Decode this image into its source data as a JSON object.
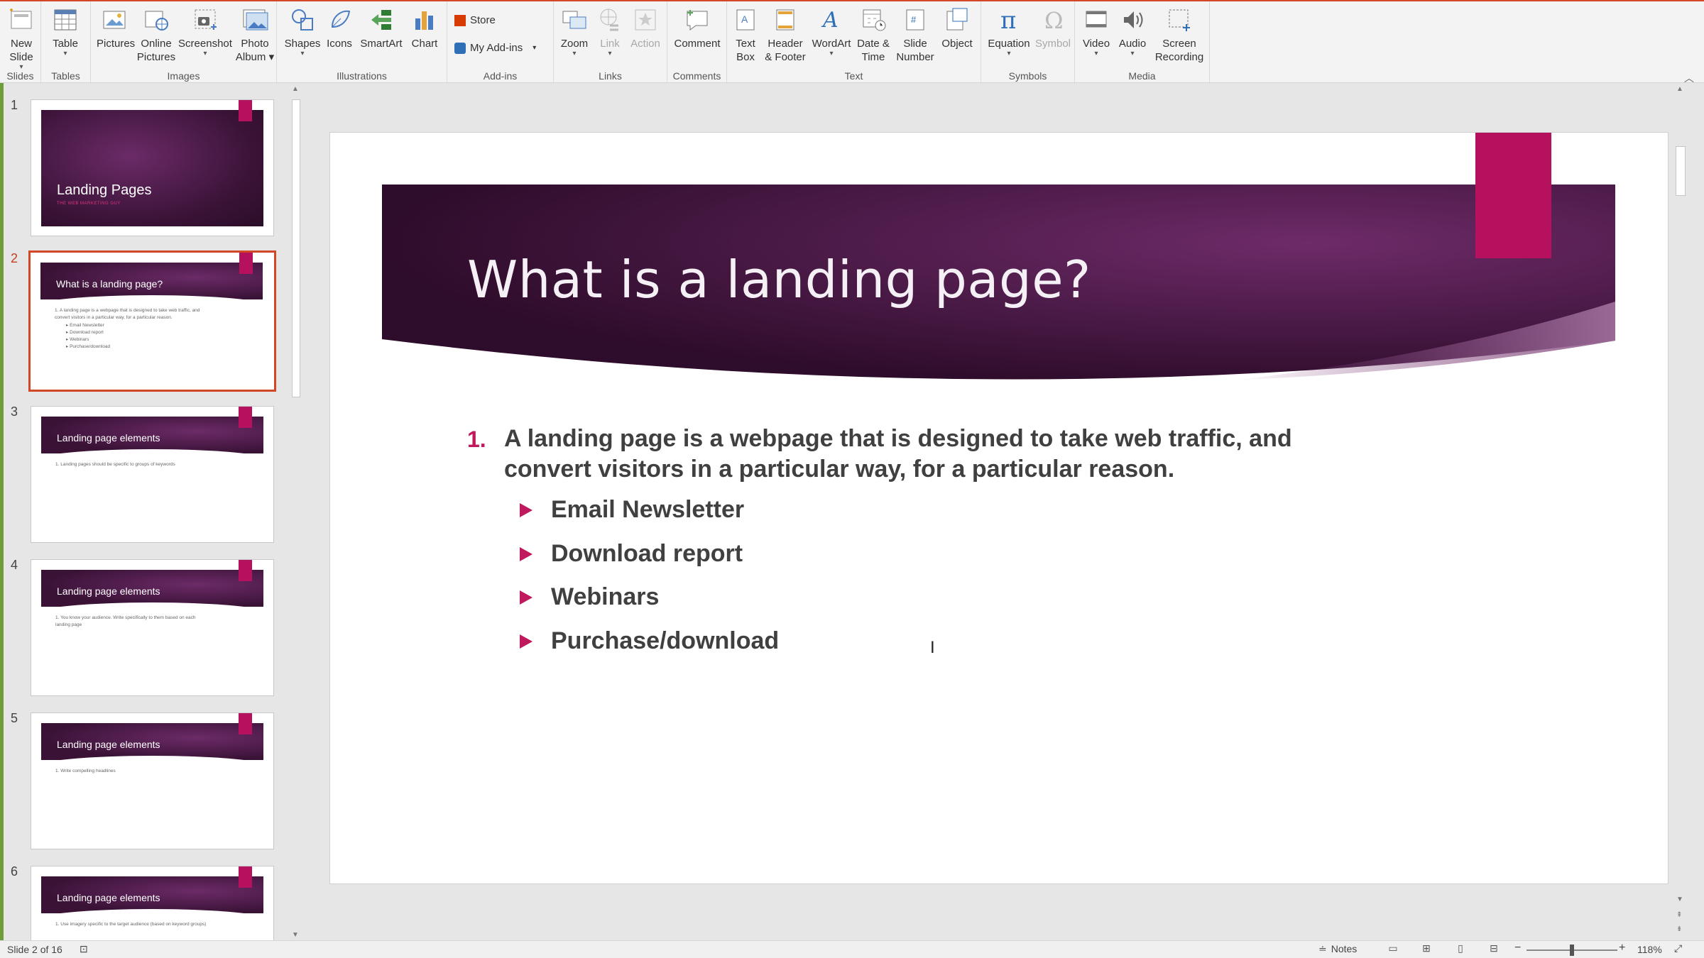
{
  "ribbon": {
    "groups": {
      "slides": "Slides",
      "tables": "Tables",
      "images": "Images",
      "illustrations": "Illustrations",
      "addins": "Add-ins",
      "links": "Links",
      "comments": "Comments",
      "text": "Text",
      "symbols": "Symbols",
      "media": "Media"
    },
    "buttons": {
      "new_slide": [
        "New",
        "Slide"
      ],
      "table": "Table",
      "pictures": "Pictures",
      "online_pictures": [
        "Online",
        "Pictures"
      ],
      "screenshot": "Screenshot",
      "photo_album": [
        "Photo",
        "Album"
      ],
      "shapes": "Shapes",
      "icons": "Icons",
      "smartart": "SmartArt",
      "chart": "Chart",
      "store": "Store",
      "my_addins": "My Add-ins",
      "zoom": "Zoom",
      "link": "Link",
      "action": "Action",
      "comment": "Comment",
      "text_box": [
        "Text",
        "Box"
      ],
      "header_footer": [
        "Header",
        "& Footer"
      ],
      "wordart": "WordArt",
      "date_time": [
        "Date &",
        "Time"
      ],
      "slide_number": [
        "Slide",
        "Number"
      ],
      "object": "Object",
      "equation": "Equation",
      "symbol": "Symbol",
      "video": "Video",
      "audio": "Audio",
      "screen_recording": [
        "Screen",
        "Recording"
      ]
    }
  },
  "thumbnails": [
    {
      "num": "1",
      "title": "Landing Pages",
      "subtitle": "THE WEB MARKETING GUY",
      "type": "cover"
    },
    {
      "num": "2",
      "title": "What is a landing page?",
      "lines": [
        "1.  A landing page is a webpage that is designed to take web traffic, and",
        "     convert visitors in a particular way, for a particular reason.",
        "▸ Email Newsletter",
        "▸ Download report",
        "▸ Webinars",
        "▸ Purchase/download"
      ],
      "selected": true
    },
    {
      "num": "3",
      "title": "Landing page elements",
      "lines": [
        "1.  Landing pages should be specific to groups of keywords"
      ]
    },
    {
      "num": "4",
      "title": "Landing page elements",
      "lines": [
        "1.  You know your audience. Write specifically to them based on each",
        "     landing page"
      ]
    },
    {
      "num": "5",
      "title": "Landing page elements",
      "lines": [
        "1.  Write compelling headlines"
      ]
    },
    {
      "num": "6",
      "title": "Landing page elements",
      "lines": [
        "1.  Use imagery specific to the target audience (based on keyword groups)"
      ]
    }
  ],
  "slide": {
    "title": "What is a landing page?",
    "number_marker": "1.",
    "main_point_line1": "A landing page is a webpage that is designed to take web traffic, and",
    "main_point_line2": "convert visitors in a particular way, for a particular reason.",
    "bullets": [
      "Email Newsletter",
      "Download report",
      "Webinars",
      "Purchase/download"
    ]
  },
  "status": {
    "slide_indicator": "Slide 2 of 16",
    "notes": "Notes",
    "zoom": "118%"
  },
  "colors": {
    "accent_magenta": "#b5115f",
    "banner_dark": "#3a1236",
    "selection_border": "#d24726"
  }
}
